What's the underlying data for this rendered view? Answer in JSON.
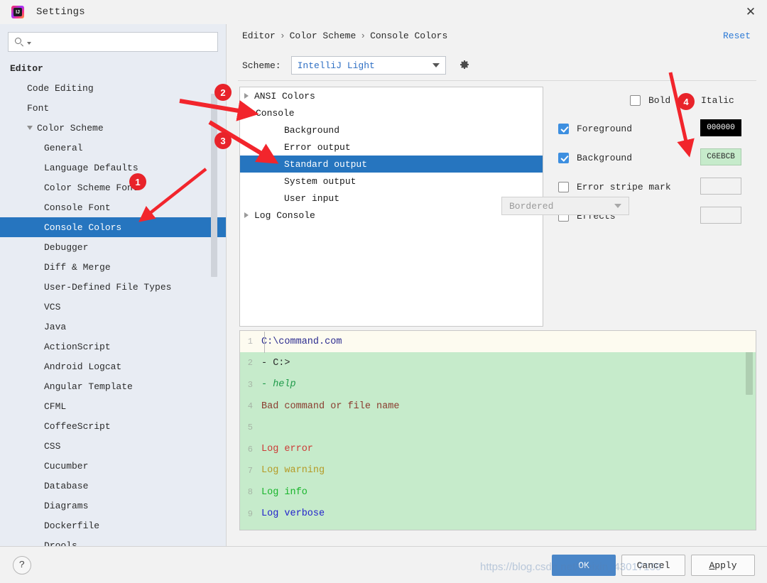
{
  "window": {
    "title": "Settings",
    "logo_icon": "intellij-idea-logo-icon",
    "logo_text": "IJ",
    "close_icon": "✕"
  },
  "sidebar": {
    "search": {
      "placeholder": "",
      "value": "",
      "icon": "search-icon"
    },
    "items": [
      {
        "label": "Editor",
        "depth": 0,
        "expanded": false,
        "selected": false
      },
      {
        "label": "Code Editing",
        "depth": 1,
        "expanded": false,
        "selected": false
      },
      {
        "label": "Font",
        "depth": 1,
        "expanded": false,
        "selected": false
      },
      {
        "label": "Color Scheme",
        "depth": 1,
        "expanded": true,
        "selected": false
      },
      {
        "label": "General",
        "depth": 2,
        "expanded": false,
        "selected": false
      },
      {
        "label": "Language Defaults",
        "depth": 2,
        "expanded": false,
        "selected": false
      },
      {
        "label": "Color Scheme Font",
        "depth": 2,
        "expanded": false,
        "selected": false
      },
      {
        "label": "Console Font",
        "depth": 2,
        "expanded": false,
        "selected": false
      },
      {
        "label": "Console Colors",
        "depth": 2,
        "expanded": false,
        "selected": true
      },
      {
        "label": "Debugger",
        "depth": 2,
        "expanded": false,
        "selected": false
      },
      {
        "label": "Diff & Merge",
        "depth": 2,
        "expanded": false,
        "selected": false
      },
      {
        "label": "User-Defined File Types",
        "depth": 2,
        "expanded": false,
        "selected": false
      },
      {
        "label": "VCS",
        "depth": 2,
        "expanded": false,
        "selected": false
      },
      {
        "label": "Java",
        "depth": 2,
        "expanded": false,
        "selected": false
      },
      {
        "label": "ActionScript",
        "depth": 2,
        "expanded": false,
        "selected": false
      },
      {
        "label": "Android Logcat",
        "depth": 2,
        "expanded": false,
        "selected": false
      },
      {
        "label": "Angular Template",
        "depth": 2,
        "expanded": false,
        "selected": false
      },
      {
        "label": "CFML",
        "depth": 2,
        "expanded": false,
        "selected": false
      },
      {
        "label": "CoffeeScript",
        "depth": 2,
        "expanded": false,
        "selected": false
      },
      {
        "label": "CSS",
        "depth": 2,
        "expanded": false,
        "selected": false
      },
      {
        "label": "Cucumber",
        "depth": 2,
        "expanded": false,
        "selected": false
      },
      {
        "label": "Database",
        "depth": 2,
        "expanded": false,
        "selected": false
      },
      {
        "label": "Diagrams",
        "depth": 2,
        "expanded": false,
        "selected": false
      },
      {
        "label": "Dockerfile",
        "depth": 2,
        "expanded": false,
        "selected": false
      },
      {
        "label": "Drools",
        "depth": 2,
        "expanded": false,
        "selected": false
      }
    ]
  },
  "header": {
    "breadcrumb": [
      "Editor",
      "Color Scheme",
      "Console Colors"
    ],
    "breadcrumb_separator": "›",
    "reset_label": "Reset"
  },
  "scheme": {
    "label": "Scheme:",
    "value": "IntelliJ Light",
    "gear_icon": "gear-icon",
    "caret_icon": "chevron-down-icon"
  },
  "attributes": {
    "items": [
      {
        "label": "ANSI Colors",
        "level": 0,
        "state": "collapsed",
        "selected": false
      },
      {
        "label": "Console",
        "level": 0,
        "state": "expanded",
        "selected": false
      },
      {
        "label": "Background",
        "level": 1,
        "state": "leaf",
        "selected": false
      },
      {
        "label": "Error output",
        "level": 1,
        "state": "leaf",
        "selected": false
      },
      {
        "label": "Standard output",
        "level": 1,
        "state": "leaf",
        "selected": true
      },
      {
        "label": "System output",
        "level": 1,
        "state": "leaf",
        "selected": false
      },
      {
        "label": "User input",
        "level": 1,
        "state": "leaf",
        "selected": false
      },
      {
        "label": "Log Console",
        "level": 0,
        "state": "collapsed",
        "selected": false
      }
    ]
  },
  "options": {
    "bold": {
      "label": "Bold",
      "checked": false
    },
    "italic": {
      "label": "Italic",
      "checked": false
    },
    "foreground": {
      "label": "Foreground",
      "checked": true,
      "color_value": "000000",
      "color_hex": "#000000"
    },
    "background": {
      "label": "Background",
      "checked": true,
      "color_value": "C6EBCB",
      "color_hex": "#C6EBCB"
    },
    "error_stripe": {
      "label": "Error stripe mark",
      "checked": false,
      "color_value": ""
    },
    "effects": {
      "label": "Effects",
      "checked": false,
      "color_value": ""
    },
    "effect_type": {
      "value": "Bordered",
      "enabled": false
    }
  },
  "preview": {
    "check_icon": "✔",
    "lines": [
      {
        "num": "1",
        "text": "C:\\command.com",
        "color": "#2b2b8f",
        "italic": false,
        "first": true
      },
      {
        "num": "2",
        "text": "- C:>",
        "color": "#2b2b2b",
        "italic": false,
        "first": false
      },
      {
        "num": "3",
        "text": "- help",
        "color": "#1f9a4a",
        "italic": true,
        "first": false
      },
      {
        "num": "4",
        "text": "Bad command or file name",
        "color": "#8a3b2e",
        "italic": false,
        "first": false
      },
      {
        "num": "5",
        "text": "",
        "color": "#2b2b2b",
        "italic": false,
        "first": false
      },
      {
        "num": "6",
        "text": "Log error",
        "color": "#cc3a36",
        "italic": false,
        "first": false
      },
      {
        "num": "7",
        "text": "Log warning",
        "color": "#b59a26",
        "italic": false,
        "first": false
      },
      {
        "num": "8",
        "text": "Log info",
        "color": "#19b52c",
        "italic": false,
        "first": false
      },
      {
        "num": "9",
        "text": "Log verbose",
        "color": "#2222cc",
        "italic": false,
        "first": false
      }
    ]
  },
  "footer": {
    "help_label": "?",
    "ok_label": "OK",
    "cancel_label": "Cancel",
    "apply_label": "Apply",
    "apply_mnemonic": "A",
    "apply_rest": "pply"
  },
  "watermark": {
    "text": "https://blog.csdn.net/weixin_43017139"
  },
  "annotations": [
    {
      "number": "1",
      "target": "sidebar-item-console-colors"
    },
    {
      "number": "2",
      "target": "attr-item-console-expander"
    },
    {
      "number": "3",
      "target": "attr-item-standard-output"
    },
    {
      "number": "4",
      "target": "background-color-swatch"
    }
  ],
  "colors": {
    "selection_blue": "#2675bf",
    "accent_blue": "#4a86c8",
    "link_blue": "#2e7bd6",
    "annotation_red": "#e8232a",
    "console_bg_green": "#c6ebcb",
    "sidebar_bg": "#e8ecf3"
  }
}
